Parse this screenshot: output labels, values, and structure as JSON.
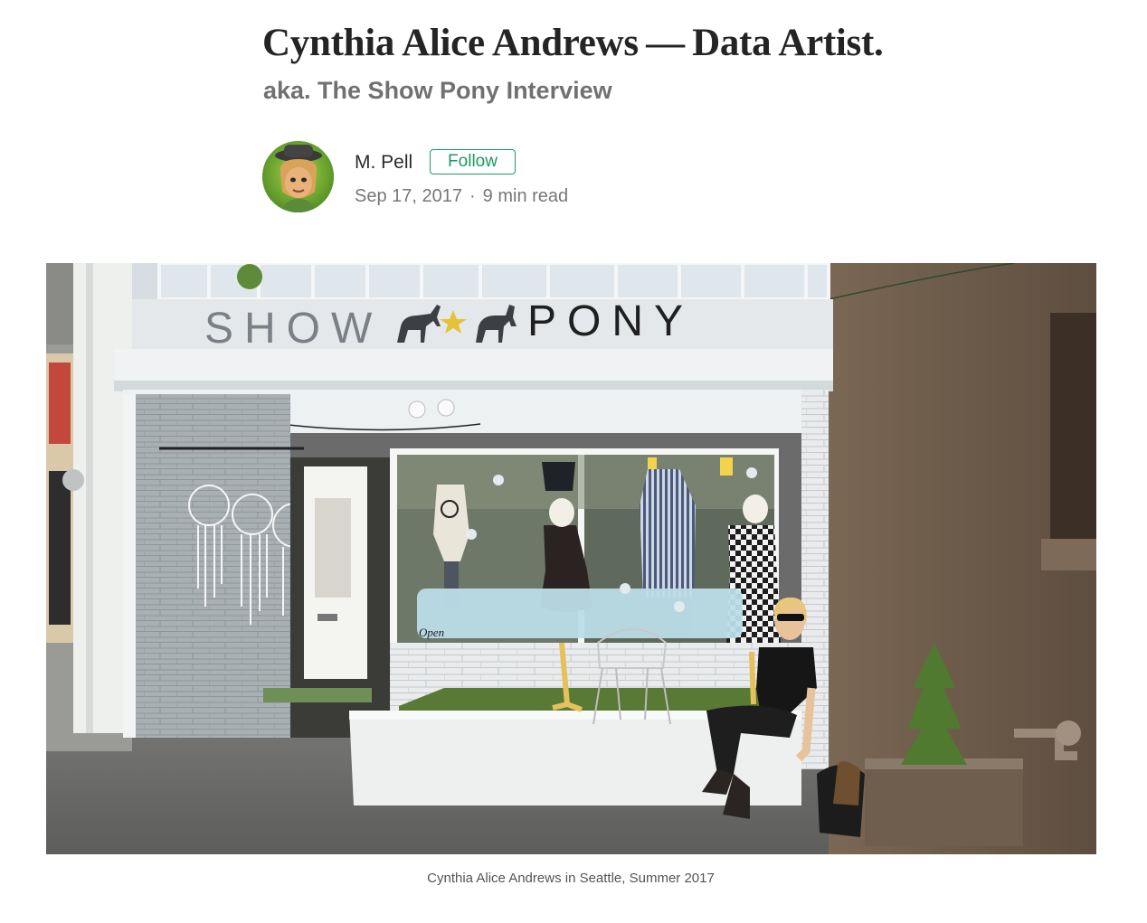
{
  "article": {
    "title": "Cynthia Alice Andrews — Data Artist.",
    "subtitle": "aka. The Show Pony Interview"
  },
  "author": {
    "name": "M. Pell",
    "follow_label": "Follow",
    "date": "Sep 17, 2017",
    "separator": "·",
    "read_time": "9 min read"
  },
  "figure": {
    "sign_left": "SHOW",
    "sign_right": "PONY",
    "window_sign": "Open",
    "caption": "Cynthia Alice Andrews in Seattle, Summer 2017"
  },
  "colors": {
    "accent": "#1c9963",
    "facade": "#c9cdcf",
    "neighbor_wall": "#6b5a4a"
  }
}
